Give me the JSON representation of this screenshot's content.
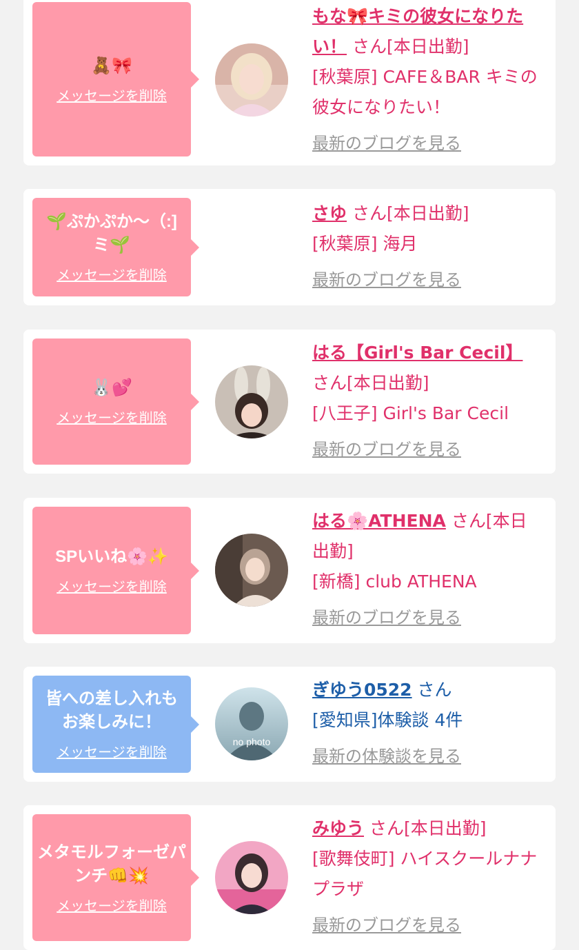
{
  "delete_label": "メッセージを削除",
  "colors": {
    "pink_bubble": "#ff9aaa",
    "blue_bubble": "#8db8f3",
    "pink_text": "#e0306a",
    "blue_text": "#1d5ea8",
    "link_gray": "#999999"
  },
  "items": [
    {
      "message": "🧸🎀",
      "name": "もな🎀キミの彼女になりたい！",
      "honorific": "さん",
      "status": "[本日出勤]",
      "shop": "[秋葉原] CAFE＆BAR キミの彼女になりたい！",
      "more_link": "最新のブログを見る",
      "has_avatar": true,
      "avatar_icon": "photo-avatar"
    },
    {
      "message": "🌱ぷかぷか〜（:]ミ🌱",
      "name": "さゆ",
      "honorific": "さん",
      "status": "[本日出勤]",
      "shop": "[秋葉原] 海月",
      "more_link": "最新のブログを見る",
      "has_avatar": false
    },
    {
      "message": "🐰💕",
      "name": "はる【Girl's Bar Cecil】",
      "honorific": "さん",
      "status": "[本日出勤]",
      "shop": "[八王子] Girl's Bar Cecil",
      "more_link": "最新のブログを見る",
      "has_avatar": true,
      "avatar_icon": "photo-avatar"
    },
    {
      "message": "SPいいね🌸✨",
      "name": "はる🌸ATHENA",
      "honorific": "さん",
      "status": "[本日出勤]",
      "shop": "[新橋] club ATHENA",
      "more_link": "最新のブログを見る",
      "has_avatar": true,
      "avatar_icon": "photo-avatar"
    },
    {
      "message": "皆への差し入れもお楽しみに！",
      "name": "ぎゆう0522",
      "honorific": "さん",
      "status": "",
      "shop": "[愛知県]体験談 4件",
      "more_link": "最新の体験談を見る",
      "has_avatar": true,
      "avatar_icon": "no-photo-icon",
      "avatar_text": "no photo"
    },
    {
      "message": "メタモルフォーゼパンチ👊💥",
      "name": "みゆう",
      "honorific": "さん",
      "status": "[本日出勤]",
      "shop": "[歌舞伎町] ハイスクールナナプラザ",
      "more_link": "最新のブログを見る",
      "has_avatar": true,
      "avatar_icon": "photo-avatar"
    }
  ]
}
